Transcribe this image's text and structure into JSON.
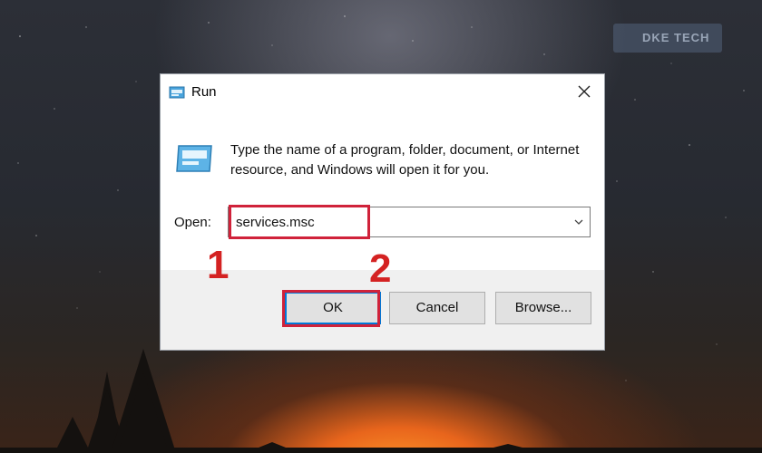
{
  "dialog": {
    "title": "Run",
    "description": "Type the name of a program, folder, document, or Internet resource, and Windows will open it for you.",
    "open_label": "Open:",
    "open_value": "services.msc",
    "buttons": {
      "ok": "OK",
      "cancel": "Cancel",
      "browse": "Browse..."
    }
  },
  "annotations": {
    "step1": "1",
    "step2": "2"
  },
  "colors": {
    "highlight": "#d0223a",
    "step_number": "#d42222",
    "accent": "#0078d7"
  },
  "icons": [
    "run-icon",
    "close-icon",
    "run-large-icon",
    "chevron-down-icon"
  ]
}
